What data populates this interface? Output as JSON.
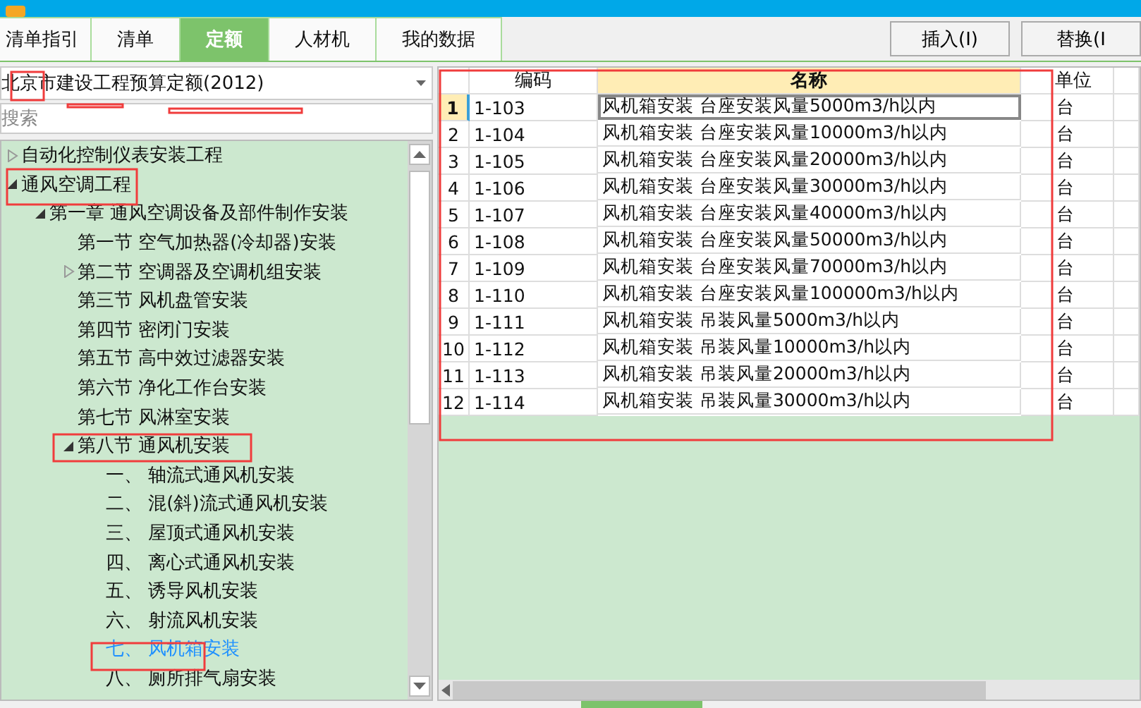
{
  "tabs": [
    {
      "label": "清单指引",
      "selected": false
    },
    {
      "label": "清单",
      "selected": false
    },
    {
      "label": "定额",
      "selected": true
    },
    {
      "label": "人材机",
      "selected": false
    },
    {
      "label": "我的数据",
      "selected": false
    }
  ],
  "actions": [
    "插入(I)",
    "替换(I"
  ],
  "library": {
    "value": "北京市建设工程预算定额(2012)"
  },
  "search": {
    "placeholder": "搜索"
  },
  "tree": [
    {
      "label": "自动化控制仪表安装工程",
      "expanded": false,
      "selected": false
    },
    {
      "label": "通风空调工程",
      "expanded": true,
      "selected": false,
      "children": [
        {
          "label": "第一章  通风空调设备及部件制作安装",
          "expanded": true,
          "selected": false,
          "children": [
            {
              "label": "第一节  空气加热器(冷却器)安装",
              "selected": false
            },
            {
              "label": "第二节  空调器及空调机组安装",
              "expanded": false,
              "selected": false
            },
            {
              "label": "第三节  风机盘管安装",
              "selected": false
            },
            {
              "label": "第四节  密闭门安装",
              "selected": false
            },
            {
              "label": "第五节  高中效过滤器安装",
              "selected": false
            },
            {
              "label": "第六节  净化工作台安装",
              "selected": false
            },
            {
              "label": "第七节  风淋室安装",
              "selected": false
            },
            {
              "label": "第八节  通风机安装",
              "expanded": true,
              "selected": false,
              "children": [
                {
                  "label": "一、  轴流式通风机安装",
                  "selected": false
                },
                {
                  "label": "二、  混(斜)流式通风机安装",
                  "selected": false
                },
                {
                  "label": "三、  屋顶式通风机安装",
                  "selected": false
                },
                {
                  "label": "四、  离心式通风机安装",
                  "selected": false
                },
                {
                  "label": "五、  诱导风机安装",
                  "selected": false
                },
                {
                  "label": "六、  射流风机安装",
                  "selected": false
                },
                {
                  "label": "七、  风机箱安装",
                  "selected": true
                },
                {
                  "label": "八、  厕所排气扇安装",
                  "selected": false
                }
              ]
            }
          ]
        }
      ]
    }
  ],
  "table": {
    "columns": [
      "编码",
      "名称",
      "单位"
    ],
    "rows": [
      {
        "index": "1",
        "code": "1-103",
        "name": "风机箱安装  台座安装风量5000m3/h以内",
        "unit": "台",
        "selected": true
      },
      {
        "index": "2",
        "code": "1-104",
        "name": "风机箱安装  台座安装风量10000m3/h以内",
        "unit": "台",
        "selected": false
      },
      {
        "index": "3",
        "code": "1-105",
        "name": "风机箱安装  台座安装风量20000m3/h以内",
        "unit": "台",
        "selected": false
      },
      {
        "index": "4",
        "code": "1-106",
        "name": "风机箱安装  台座安装风量30000m3/h以内",
        "unit": "台",
        "selected": false
      },
      {
        "index": "5",
        "code": "1-107",
        "name": "风机箱安装  台座安装风量40000m3/h以内",
        "unit": "台",
        "selected": false
      },
      {
        "index": "6",
        "code": "1-108",
        "name": "风机箱安装  台座安装风量50000m3/h以内",
        "unit": "台",
        "selected": false
      },
      {
        "index": "7",
        "code": "1-109",
        "name": "风机箱安装  台座安装风量70000m3/h以内",
        "unit": "台",
        "selected": false
      },
      {
        "index": "8",
        "code": "1-110",
        "name": "风机箱安装  台座安装风量100000m3/h以内",
        "unit": "台",
        "selected": false
      },
      {
        "index": "9",
        "code": "1-111",
        "name": "风机箱安装  吊装风量5000m3/h以内",
        "unit": "台",
        "selected": false
      },
      {
        "index": "10",
        "code": "1-112",
        "name": "风机箱安装  吊装风量10000m3/h以内",
        "unit": "台",
        "selected": false
      },
      {
        "index": "11",
        "code": "1-113",
        "name": "风机箱安装  吊装风量20000m3/h以内",
        "unit": "台",
        "selected": false
      },
      {
        "index": "12",
        "code": "1-114",
        "name": "风机箱安装  吊装风量30000m3/h以内",
        "unit": "台",
        "selected": false
      }
    ]
  }
}
